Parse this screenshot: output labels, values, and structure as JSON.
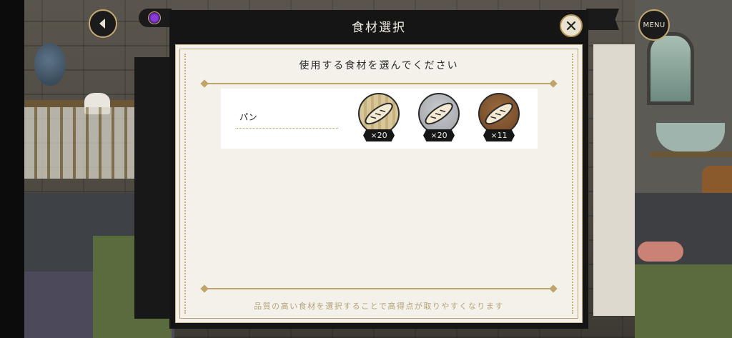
{
  "dialog": {
    "title": "食材選択",
    "instruction": "使用する食材を選んでください",
    "footer_hint": "品質の高い食材を選択することで高得点が取りやすくなります"
  },
  "hud": {
    "menu_label": "MENU"
  },
  "ingredients": [
    {
      "name": "パン",
      "items": [
        {
          "quality": "low",
          "count": "×20",
          "color": "#d8c79a"
        },
        {
          "quality": "mid",
          "count": "×20",
          "color": "#b7b9bd"
        },
        {
          "quality": "high",
          "count": "×11",
          "color": "#8a5c33"
        }
      ]
    }
  ],
  "colors": {
    "accent_gold": "#bfa56b",
    "dialog_bg": "#151515",
    "paper_bg": "#f3f1ea"
  }
}
